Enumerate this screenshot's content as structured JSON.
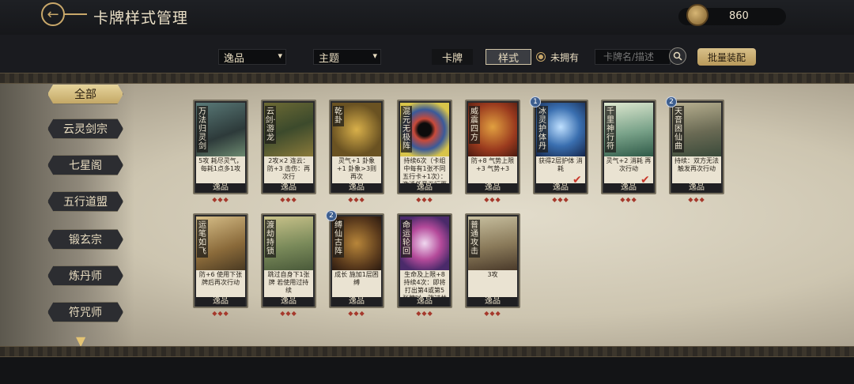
{
  "header": {
    "title": "卡牌样式管理",
    "currency_value": "860"
  },
  "filters": {
    "rarity_select": "逸品",
    "theme_select": "主题",
    "tab_card": "卡牌",
    "tab_style": "样式",
    "not_owned_label": "未拥有",
    "search_placeholder": "卡牌名/描述",
    "batch_button": "批量装配"
  },
  "sidebar": {
    "items": [
      {
        "label": "全部"
      },
      {
        "label": "云灵剑宗"
      },
      {
        "label": "七星阁"
      },
      {
        "label": "五行道盟"
      },
      {
        "label": "锻玄宗"
      },
      {
        "label": "炼丹师"
      },
      {
        "label": "符咒师"
      }
    ]
  },
  "cards": [
    {
      "name": "万法归灵剑",
      "desc": "5攻 耗尽灵气，每耗1点多1攻",
      "label": "逸品",
      "badge": "",
      "checked": false
    },
    {
      "name": "云剑·游龙",
      "desc": "2攻×2 连云：防+3 击伤：再次行",
      "label": "逸品",
      "badge": "",
      "checked": false
    },
    {
      "name": "乾卦",
      "desc": "灵气+1 卦象+1 卦象>3则再次",
      "label": "逸品",
      "badge": "",
      "checked": false
    },
    {
      "name": "混元无极阵",
      "desc": "持续6次（卡组中每有1张不同五行卡+1次）：激活任意五行再次",
      "label": "逸品",
      "badge": "",
      "checked": false
    },
    {
      "name": "威震四方",
      "desc": "防+8 气势上限+3 气势+3",
      "label": "逸品",
      "badge": "",
      "checked": false
    },
    {
      "name": "冰灵护体丹",
      "desc": "获得2层护体 消耗",
      "label": "逸品",
      "badge": "1",
      "checked": true
    },
    {
      "name": "千里神行符",
      "desc": "灵气+2 消耗 再次行动",
      "label": "逸品",
      "badge": "",
      "checked": true
    },
    {
      "name": "天音困仙曲",
      "desc": "持续：双方无法触发再次行动",
      "label": "逸品",
      "badge": "2",
      "checked": false
    },
    {
      "name": "运笔如飞",
      "desc": "防+6 使用下张牌后再次行动",
      "label": "逸品",
      "badge": "",
      "checked": false
    },
    {
      "name": "渡劫持锁",
      "desc": "跳过自身下1张牌 若使用过持续",
      "label": "逸品",
      "badge": "",
      "checked": false
    },
    {
      "name": "缚仙古阵",
      "desc": "成长 施加1层困缚",
      "label": "逸品",
      "badge": "2",
      "checked": false
    },
    {
      "name": "命运轮回",
      "desc": "生命及上限+8 持续4次：即将打出第4或第5张牌时，跳过并抽发",
      "label": "逸品",
      "badge": "",
      "checked": false
    },
    {
      "name": "普通攻击",
      "desc": "3攻",
      "label": "逸品",
      "badge": "",
      "checked": false
    }
  ],
  "colors": {
    "gold": "#c9a86a",
    "parchment": "#e2dccb",
    "active_tab": "#d8c089",
    "diamond": "#a5392c"
  }
}
